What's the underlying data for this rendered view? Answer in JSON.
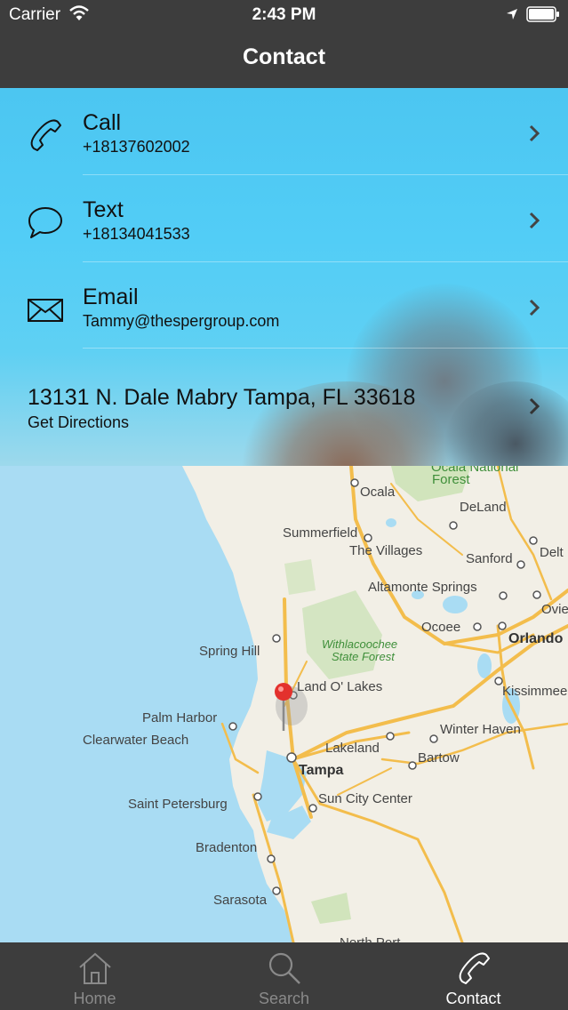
{
  "status_bar": {
    "carrier": "Carrier",
    "time": "2:43 PM"
  },
  "nav": {
    "title": "Contact"
  },
  "contact": {
    "call": {
      "label": "Call",
      "value": "+18137602002",
      "icon": "phone-icon"
    },
    "text": {
      "label": "Text",
      "value": "+18134041533",
      "icon": "speech-bubble-icon"
    },
    "email": {
      "label": "Email",
      "value": "Tammy@thespergroup.com",
      "icon": "envelope-icon"
    },
    "address": {
      "line": "13131 N. Dale Mabry Tampa, FL 33618",
      "directions": "Get Directions"
    }
  },
  "map": {
    "labels": {
      "ocala": "Ocala",
      "ocala_forest_1": "Ocala National",
      "ocala_forest_2": "Forest",
      "deland": "DeLand",
      "summerfield": "Summerfield",
      "villages": "The Villages",
      "sanford": "Sanford",
      "delt": "Delt",
      "altamonte": "Altamonte Springs",
      "ovie": "Ovie",
      "ocoee": "Ocoee",
      "orlando": "Orlando",
      "spring_hill": "Spring Hill",
      "withlacoochee_1": "Withlacoochee",
      "withlacoochee_2": "State Forest",
      "kissimmee": "Kissimmee",
      "land_o_lakes": "Land O' Lakes",
      "palm_harbor": "Palm Harbor",
      "clearwater": "Clearwater Beach",
      "winter_haven": "Winter Haven",
      "lakeland": "Lakeland",
      "bartow": "Bartow",
      "tampa": "Tampa",
      "sun_city": "Sun City Center",
      "st_pete": "Saint Petersburg",
      "bradenton": "Bradenton",
      "sarasota": "Sarasota",
      "north_port": "North Port"
    },
    "colors": {
      "water": "#a9dcf3",
      "land": "#f2efe6",
      "road": "#f3bd4c",
      "park": "#c8e1b2"
    }
  },
  "tabs": [
    {
      "label": "Home",
      "icon": "home-icon",
      "active": false
    },
    {
      "label": "Search",
      "icon": "search-icon",
      "active": false
    },
    {
      "label": "Contact",
      "icon": "phone-icon",
      "active": true
    }
  ]
}
